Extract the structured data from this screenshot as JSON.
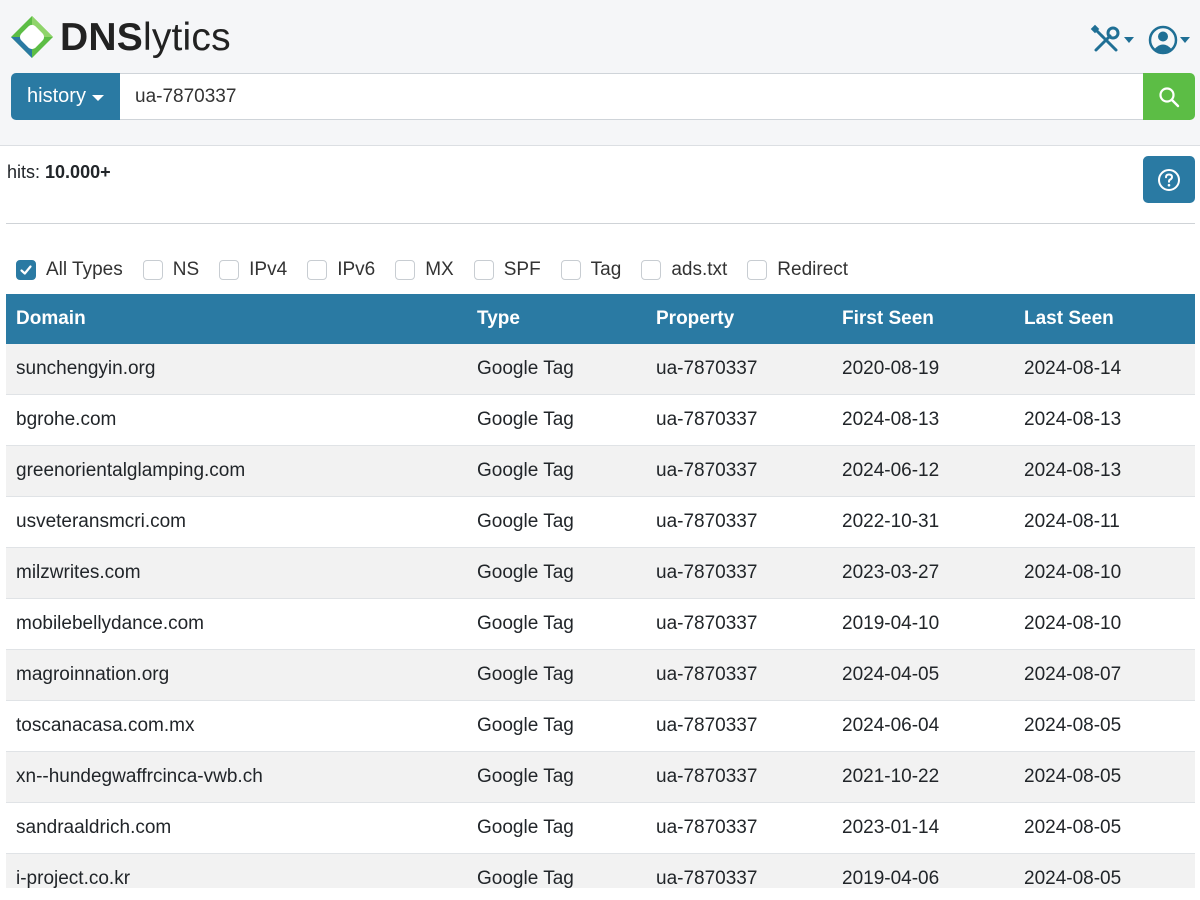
{
  "app": {
    "logo_text_bold": "DNS",
    "logo_text_rest": "lytics",
    "brand_colors": {
      "primary": "#2a7aa3",
      "search": "#5cbd45",
      "logo_green": "#5cbd45",
      "logo_blue": "#2a7aa3"
    }
  },
  "header": {
    "tools_icon": "tools-icon",
    "user_icon": "user-circle-icon"
  },
  "search": {
    "mode_label": "history",
    "value": "ua-7870337",
    "button_icon": "search-icon"
  },
  "results": {
    "hits_label": "hits:",
    "hits_value": "10.000+",
    "help_icon": "question-circle-icon"
  },
  "filters": [
    {
      "label": "All Types",
      "checked": true
    },
    {
      "label": "NS",
      "checked": false
    },
    {
      "label": "IPv4",
      "checked": false
    },
    {
      "label": "IPv6",
      "checked": false
    },
    {
      "label": "MX",
      "checked": false
    },
    {
      "label": "SPF",
      "checked": false
    },
    {
      "label": "Tag",
      "checked": false
    },
    {
      "label": "ads.txt",
      "checked": false
    },
    {
      "label": "Redirect",
      "checked": false
    }
  ],
  "table": {
    "headers": [
      "Domain",
      "Type",
      "Property",
      "First Seen",
      "Last Seen"
    ],
    "rows": [
      [
        "sunchengyin.org",
        "Google Tag",
        "ua-7870337",
        "2020-08-19",
        "2024-08-14"
      ],
      [
        "bgrohe.com",
        "Google Tag",
        "ua-7870337",
        "2024-08-13",
        "2024-08-13"
      ],
      [
        "greenorientalglamping.com",
        "Google Tag",
        "ua-7870337",
        "2024-06-12",
        "2024-08-13"
      ],
      [
        "usveteransmcri.com",
        "Google Tag",
        "ua-7870337",
        "2022-10-31",
        "2024-08-11"
      ],
      [
        "milzwrites.com",
        "Google Tag",
        "ua-7870337",
        "2023-03-27",
        "2024-08-10"
      ],
      [
        "mobilebellydance.com",
        "Google Tag",
        "ua-7870337",
        "2019-04-10",
        "2024-08-10"
      ],
      [
        "magroinnation.org",
        "Google Tag",
        "ua-7870337",
        "2024-04-05",
        "2024-08-07"
      ],
      [
        "toscanacasa.com.mx",
        "Google Tag",
        "ua-7870337",
        "2024-06-04",
        "2024-08-05"
      ],
      [
        "xn--hundegwaffrcinca-vwb.ch",
        "Google Tag",
        "ua-7870337",
        "2021-10-22",
        "2024-08-05"
      ],
      [
        "sandraaldrich.com",
        "Google Tag",
        "ua-7870337",
        "2023-01-14",
        "2024-08-05"
      ],
      [
        "i-project.co.kr",
        "Google Tag",
        "ua-7870337",
        "2019-04-06",
        "2024-08-05"
      ]
    ]
  }
}
